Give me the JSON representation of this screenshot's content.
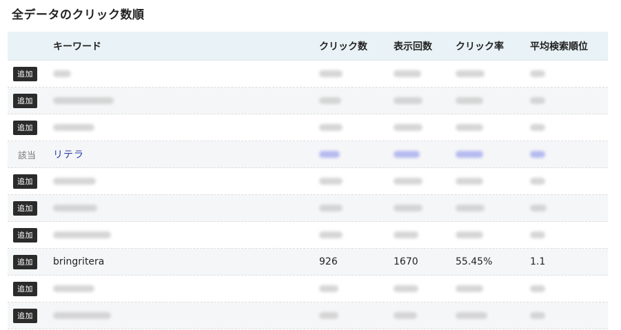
{
  "page": {
    "title": "全データのクリック数順"
  },
  "table": {
    "headers": {
      "keyword": "キーワード",
      "clicks": "クリック数",
      "impressions": "表示回数",
      "ctr": "クリック率",
      "position": "平均検索順位"
    },
    "add_label": "追加",
    "match_label": "該当",
    "rows": [
      {
        "type": "blurred"
      },
      {
        "type": "blurred"
      },
      {
        "type": "blurred"
      },
      {
        "type": "match",
        "keyword": "リテラ"
      },
      {
        "type": "blurred"
      },
      {
        "type": "blurred"
      },
      {
        "type": "blurred"
      },
      {
        "type": "visible",
        "keyword": "bringritera",
        "clicks": "926",
        "impressions": "1670",
        "ctr": "55.45%",
        "position": "1.1"
      },
      {
        "type": "blurred"
      },
      {
        "type": "blurred"
      }
    ]
  },
  "colors": {
    "header_bg": "#e9f2f6",
    "alt_row_bg": "#f5f6f8",
    "add_button_bg": "#2b2b2b",
    "link_color": "#2b3aa8"
  }
}
